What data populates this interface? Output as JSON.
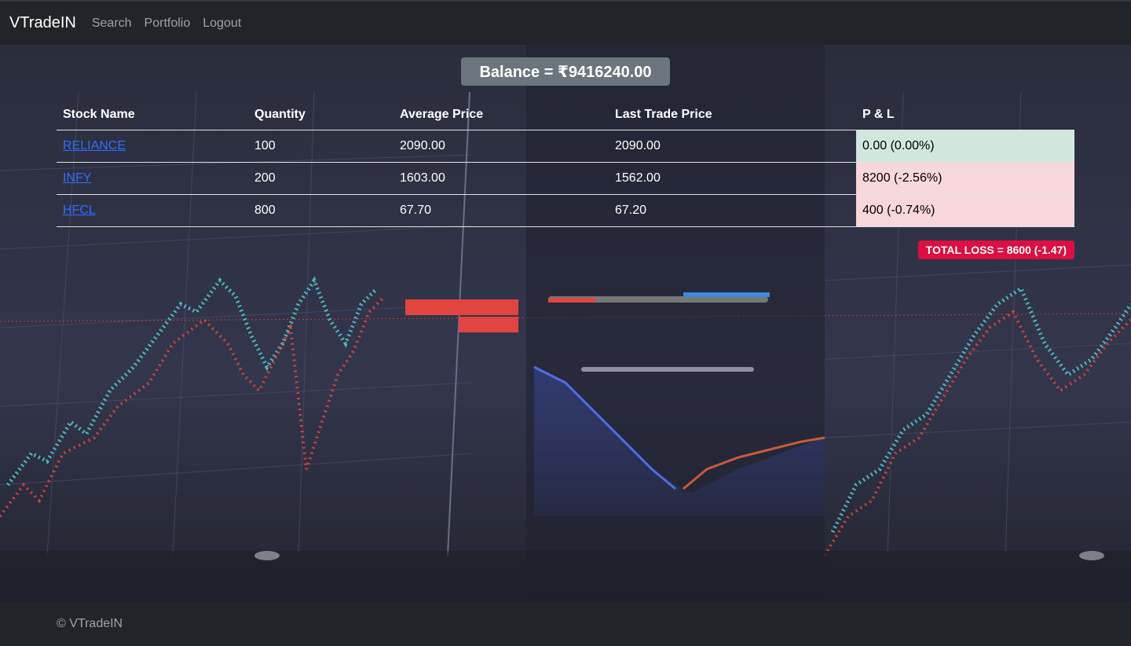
{
  "app": {
    "brand": "VTradeIN",
    "nav": [
      "Search",
      "Portfolio",
      "Logout"
    ]
  },
  "balance": {
    "label": "Balance = ₹9416240.00"
  },
  "table": {
    "headers": [
      "Stock Name",
      "Quantity",
      "Average Price",
      "Last Trade Price",
      "P & L"
    ],
    "rows": [
      {
        "name": "RELIANCE",
        "quantity": "100",
        "avg": "2090.00",
        "ltp": "2090.00",
        "pl": "0.00 (0.00%)",
        "status": "profit"
      },
      {
        "name": "INFY",
        "quantity": "200",
        "avg": "1603.00",
        "ltp": "1562.00",
        "pl": "8200 (-2.56%)",
        "status": "loss"
      },
      {
        "name": "HFCL",
        "quantity": "800",
        "avg": "67.70",
        "ltp": "67.20",
        "pl": "400 (-0.74%)",
        "status": "loss"
      }
    ]
  },
  "total": {
    "label": "TOTAL LOSS = 8600 (-1.47)"
  },
  "footer": {
    "text": "© VTradeIN"
  },
  "colors": {
    "navbar": "#212529",
    "balance_badge": "#6c757d",
    "profit_row": "#d1e7dd",
    "loss_row": "#f8d7da",
    "total_loss_badge": "#dc0f40",
    "link": "#2f6dff"
  }
}
